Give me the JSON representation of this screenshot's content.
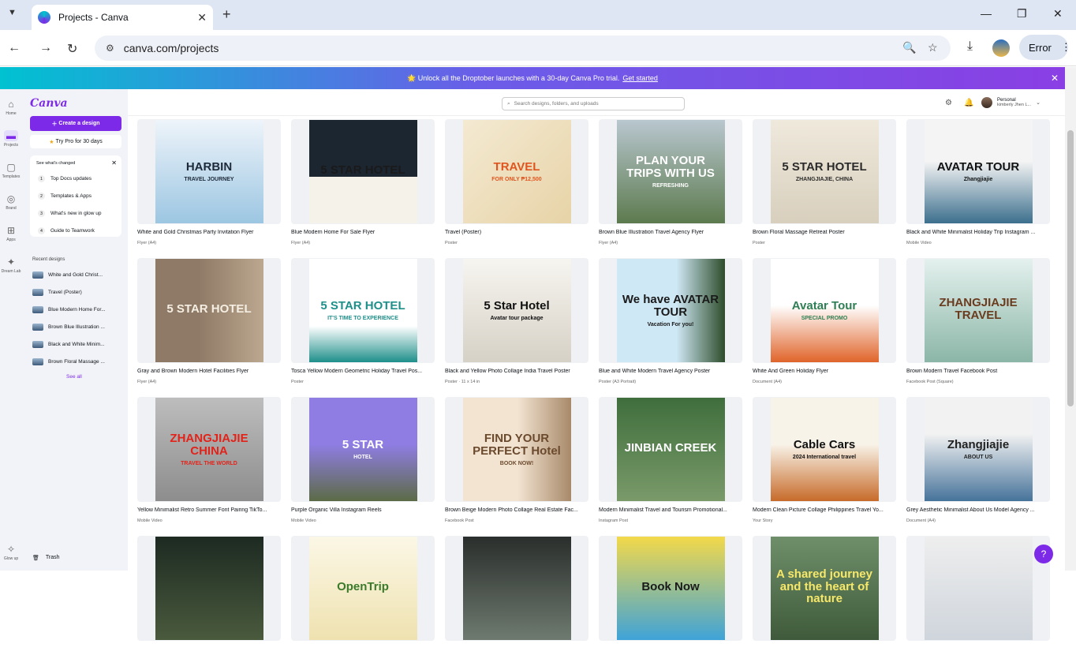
{
  "browser": {
    "tab_title": "Projects - Canva",
    "url": "canva.com/projects",
    "error_label": "Error"
  },
  "promo": {
    "text": "🌟 Unlock all the Droptober launches with a 30-day Canva Pro trial.",
    "link": "Get started"
  },
  "rail": [
    {
      "label": "Home",
      "icon": "⌂"
    },
    {
      "label": "Projects",
      "icon": "▬"
    },
    {
      "label": "Templates",
      "icon": "▢"
    },
    {
      "label": "Brand",
      "icon": "◎"
    },
    {
      "label": "Apps",
      "icon": "⊞"
    },
    {
      "label": "Dream Lab",
      "icon": "✦"
    },
    {
      "label": "Glow up",
      "icon": "✧"
    }
  ],
  "sidebar": {
    "logo": "Canva",
    "create_label": "Create a design",
    "trypro_label": "Try Pro for 30 days",
    "changed_title": "See what's changed",
    "changed_items": [
      {
        "num": "1",
        "label": "Top Docs updates"
      },
      {
        "num": "2",
        "label": "Templates & Apps"
      },
      {
        "num": "3",
        "label": "What's new in glow up"
      },
      {
        "num": "4",
        "label": "Guide to Teamwork"
      }
    ],
    "recent_title": "Recent designs",
    "recent": [
      "White and Gold Christ...",
      "Travel (Poster)",
      "Blue Modern Home For...",
      "Brown Blue Illustration ...",
      "Black and White Minim...",
      "Brown Floral Massage ..."
    ],
    "see_all": "See all",
    "trash": "Trash"
  },
  "topbar": {
    "search_placeholder": "Search designs, folders, and uploads",
    "account_type": "Personal",
    "account_name": "kimberly Jhen L..."
  },
  "designs": [
    {
      "title": "White and Gold Christmas Party Invitation Flyer",
      "sub": "Flyer (A4)",
      "art": "HARBIN",
      "art2": "TRAVEL JOURNEY",
      "bg": "linear-gradient(#eef4fa,#9cc6e2)",
      "fg": "#1d2a3a"
    },
    {
      "title": "Blue Modern Home For Sale Flyer",
      "sub": "Flyer (A4)",
      "art": "5 STAR HOTEL",
      "art2": "",
      "bg": "linear-gradient(#1c2631 55%,#f5f2ea 55%)",
      "fg": "#1a1a1a"
    },
    {
      "title": "Travel (Poster)",
      "sub": "Poster",
      "art": "TRAVEL",
      "art2": "FOR ONLY ₱12,500",
      "bg": "linear-gradient(135deg,#f4ead2,#e7d3a7)",
      "fg": "#e0551f"
    },
    {
      "title": "Brown Blue Illustration Travel Agency Flyer",
      "sub": "Flyer (A4)",
      "art": "PLAN YOUR TRIPS WITH US",
      "art2": "REFRESHING",
      "bg": "linear-gradient(#b9c7cf,#5c7a4e)",
      "fg": "#ffffff"
    },
    {
      "title": "Brown Floral Massage Retreat Poster",
      "sub": "Poster",
      "art": "5 STAR HOTEL",
      "art2": "ZHANGJIAJIE, CHINA",
      "bg": "linear-gradient(#efe9dc,#d8cfbd)",
      "fg": "#2b2b2b"
    },
    {
      "title": "Black and White Minimalist Holiday Trip Instagram ...",
      "sub": "Mobile Video",
      "art": "AVATAR TOUR",
      "art2": "Zhangjiajie",
      "bg": "linear-gradient(#f4f4f4 40%,#3c6f8d)",
      "fg": "#111111"
    },
    {
      "title": "Gray and Brown Modern Hotel Facilities Flyer",
      "sub": "Flyer (A4)",
      "art": "5 STAR HOTEL",
      "art2": "",
      "bg": "linear-gradient(90deg,#8e7a66 40%,#bca88f)",
      "fg": "#f5eee2"
    },
    {
      "title": "Tosca Yellow Modern Geometric Holiday Travel Pos...",
      "sub": "Poster",
      "art": "5 STAR HOTEL",
      "art2": "IT'S TIME TO EXPERIENCE",
      "bg": "linear-gradient(#ffffff 65%,#1f8f8a)",
      "fg": "#1f8f8a"
    },
    {
      "title": "Black and Yellow Photo Collage India Travel Poster",
      "sub": "Poster · 11 x 14 in",
      "art": "5 Star Hotel",
      "art2": "Avatar tour package",
      "bg": "linear-gradient(#f7f5f0,#d6d1c6)",
      "fg": "#111111"
    },
    {
      "title": "Blue and White Modern Travel Agency Poster",
      "sub": "Poster (A3 Portrait)",
      "art": "We have AVATAR TOUR",
      "art2": "Vacation For you!",
      "bg": "linear-gradient(90deg,#cfe8f6 55%,#2d4d2a)",
      "fg": "#1a1a1a"
    },
    {
      "title": "White And Green Holiday Flyer",
      "sub": "Document (A4)",
      "art": "Avatar Tour",
      "art2": "SPECIAL PROMO",
      "bg": "linear-gradient(#ffffff 45%,#e0642a)",
      "fg": "#2e7f55"
    },
    {
      "title": "Brown Modern Travel Facebook Post",
      "sub": "Facebook Post (Square)",
      "art": "ZHANGJIAJIE TRAVEL",
      "art2": "",
      "bg": "linear-gradient(#e4f1ee,#8bb6a7)",
      "fg": "#6b3b1e"
    },
    {
      "title": "Yellow Minimalist Retro Summer Font Pairing TikTo...",
      "sub": "Mobile Video",
      "art": "ZHANGJIAJIE CHINA",
      "art2": "TRAVEL THE WORLD",
      "bg": "linear-gradient(#bdbdbd,#8d8d8d)",
      "fg": "#e2231a"
    },
    {
      "title": "Purple Organic Villa Instagram Reels",
      "sub": "Mobile Video",
      "art": "5 STAR",
      "art2": "HOTEL",
      "bg": "linear-gradient(#8f7de4 45%,#5c6b46)",
      "fg": "#ffffff"
    },
    {
      "title": "Brown Beige Modern Photo Collage Real Estate Fac...",
      "sub": "Facebook Post",
      "art": "FIND YOUR PERFECT Hotel",
      "art2": "BOOK NOW!",
      "bg": "linear-gradient(90deg,#f3e4d2 50%,#a88a6a)",
      "fg": "#6b4a2e"
    },
    {
      "title": "Modern Minimalist Travel and Tourism Promotional...",
      "sub": "Instagram Post",
      "art": "JINBIAN CREEK",
      "art2": "",
      "bg": "linear-gradient(#3f6e3c,#7a9a6a)",
      "fg": "#ffffff"
    },
    {
      "title": "Modern Clean Picture Collage Philippines Travel Yo...",
      "sub": "Your Story",
      "art": "Cable Cars",
      "art2": "2024 International travel",
      "bg": "linear-gradient(#f8f3e8 45%,#c76b2a)",
      "fg": "#111111"
    },
    {
      "title": "Grey Aesthetic Minimalist About Us Model Agency ...",
      "sub": "Document (A4)",
      "art": "Zhangjiajie",
      "art2": "ABOUT US",
      "bg": "linear-gradient(#f2f2f2 35%,#46739a)",
      "fg": "#222222"
    },
    {
      "title": "",
      "sub": "",
      "art": "",
      "art2": "",
      "bg": "linear-gradient(#1d2a22,#4a5a3d)",
      "fg": "#ffffff"
    },
    {
      "title": "",
      "sub": "",
      "art": "OpenTrip",
      "art2": "",
      "bg": "linear-gradient(#fbf7e6,#efe2b0)",
      "fg": "#3a7a2a"
    },
    {
      "title": "",
      "sub": "",
      "art": "",
      "art2": "",
      "bg": "linear-gradient(#2a2e2c,#6e7a6f)",
      "fg": "#ffffff"
    },
    {
      "title": "",
      "sub": "",
      "art": "Book Now",
      "art2": "",
      "bg": "linear-gradient(#f3d94a,#3fa3d8)",
      "fg": "#1a1a1a"
    },
    {
      "title": "",
      "sub": "",
      "art": "A shared journey and the heart of nature",
      "art2": "",
      "bg": "linear-gradient(#6f8f6a,#3e5a3a)",
      "fg": "#f7e86a"
    },
    {
      "title": "",
      "sub": "",
      "art": "",
      "art2": "",
      "bg": "linear-gradient(#eeeeee,#cfd5dc)",
      "fg": "#222222"
    }
  ]
}
